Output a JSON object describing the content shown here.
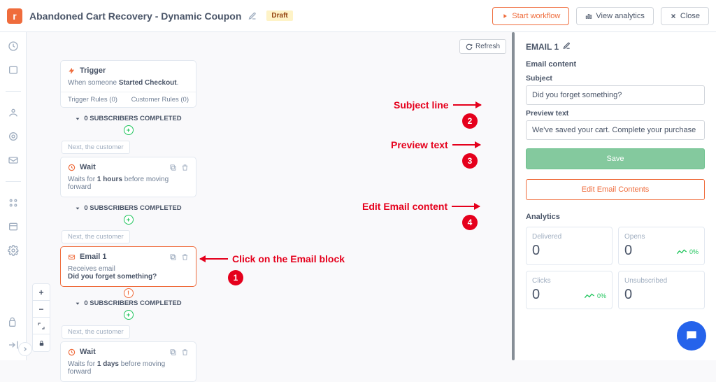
{
  "header": {
    "logo_letter": "r",
    "title": "Abandoned Cart Recovery - Dynamic Coupon",
    "badge": "Draft",
    "start": "Start workflow",
    "analytics": "View analytics",
    "close": "Close"
  },
  "refresh": "Refresh",
  "flow": {
    "trigger": {
      "title": "Trigger",
      "line_a": "When someone ",
      "line_b": "Started Checkout",
      "line_c": ".",
      "rules_a": "Trigger Rules (0)",
      "rules_b": "Customer Rules (0)"
    },
    "subscribers": "0 SUBSCRIBERS COMPLETED",
    "next": "Next, the customer",
    "wait1": {
      "title": "Wait",
      "body_a": "Waits for ",
      "body_b": "1 hours",
      "body_c": " before moving forward"
    },
    "email": {
      "title": "Email 1",
      "body_a": "Receives email",
      "body_b": "Did you forget something?"
    },
    "wait2": {
      "title": "Wait",
      "body_a": "Waits for ",
      "body_b": "1 days",
      "body_c": " before moving forward"
    }
  },
  "panel": {
    "heading": "EMAIL 1",
    "section": "Email content",
    "subject_lbl": "Subject",
    "subject_val": "Did you forget something?",
    "preview_lbl": "Preview text",
    "preview_val": "We've saved your cart. Complete your purchase now",
    "save": "Save",
    "edit": "Edit Email Contents",
    "analytics_head": "Analytics",
    "delivered_lbl": "Delivered",
    "delivered_val": "0",
    "opens_lbl": "Opens",
    "opens_val": "0",
    "opens_pct": "0%",
    "clicks_lbl": "Clicks",
    "clicks_val": "0",
    "clicks_pct": "0%",
    "unsub_lbl": "Unsubscribed",
    "unsub_val": "0"
  },
  "anno": {
    "a1": "Click on the Email block",
    "a2": "Subject line",
    "a3": "Preview text",
    "a4": "Edit Email content",
    "n1": "1",
    "n2": "2",
    "n3": "3",
    "n4": "4"
  }
}
